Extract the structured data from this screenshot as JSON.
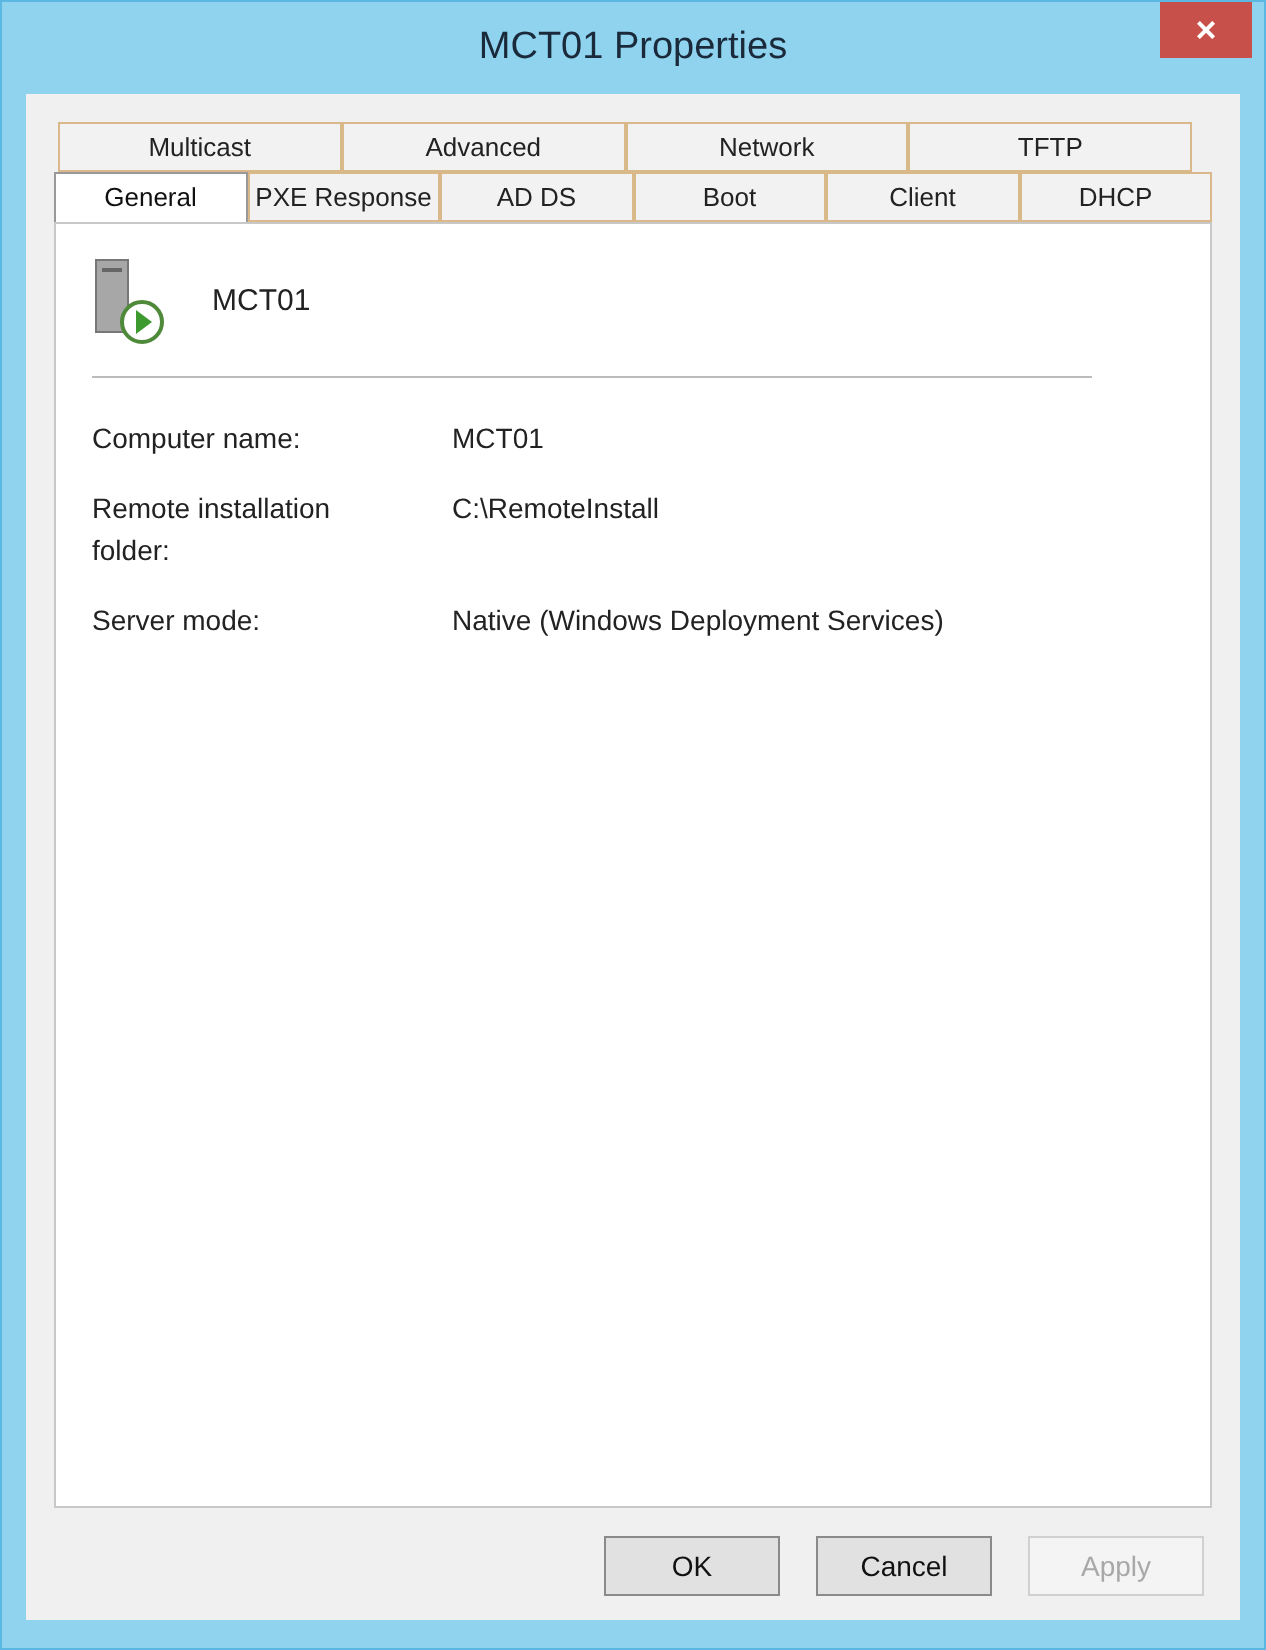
{
  "window": {
    "title": "MCT01 Properties",
    "close": "×"
  },
  "tab_rows": [
    [
      {
        "label": "Multicast",
        "selected": false
      },
      {
        "label": "Advanced",
        "selected": false
      },
      {
        "label": "Network",
        "selected": false
      },
      {
        "label": "TFTP",
        "selected": false
      }
    ],
    [
      {
        "label": "General",
        "selected": true
      },
      {
        "label": "PXE Response",
        "selected": false
      },
      {
        "label": "AD DS",
        "selected": false
      },
      {
        "label": "Boot",
        "selected": false
      },
      {
        "label": "Client",
        "selected": false
      },
      {
        "label": "DHCP",
        "selected": false
      }
    ]
  ],
  "header": {
    "name": "MCT01"
  },
  "properties": [
    {
      "label": "Computer name:",
      "value": "MCT01"
    },
    {
      "label": "Remote installation folder:",
      "value": "C:\\RemoteInstall"
    },
    {
      "label": "Server mode:",
      "value": "Native (Windows Deployment Services)"
    }
  ],
  "buttons": [
    {
      "label": "OK",
      "disabled": false
    },
    {
      "label": "Cancel",
      "disabled": false
    },
    {
      "label": "Apply",
      "disabled": true
    }
  ]
}
